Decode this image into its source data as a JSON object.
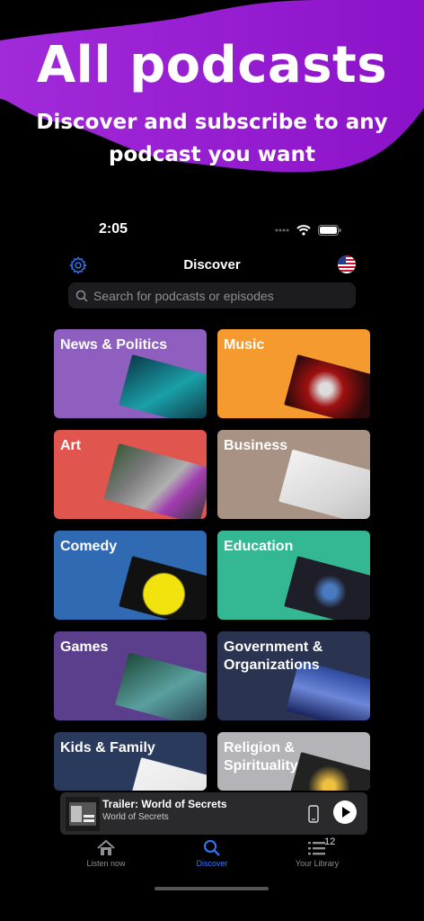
{
  "promo": {
    "headline": "All podcasts",
    "subline_1": "Discover and subscribe to any",
    "subline_2": "podcast you want"
  },
  "status": {
    "time": "2:05"
  },
  "nav": {
    "title": "Discover"
  },
  "search": {
    "placeholder": "Search for podcasts or episodes"
  },
  "categories": [
    {
      "label": "News & Politics",
      "color": "#8e5fbf"
    },
    {
      "label": "Music",
      "color": "#f49a2f"
    },
    {
      "label": "Art",
      "color": "#e0554e"
    },
    {
      "label": "Business",
      "color": "#a89283"
    },
    {
      "label": "Comedy",
      "color": "#2f6ab3"
    },
    {
      "label": "Education",
      "color": "#33b893"
    },
    {
      "label": "Games",
      "color": "#5c3f8c"
    },
    {
      "label": "Government & Organizations",
      "color": "#2a3350"
    },
    {
      "label": "Kids & Family",
      "color": "#2a3a5c"
    },
    {
      "label": "Religion & Spirituality",
      "color": "#b4b4b8"
    }
  ],
  "player": {
    "title": "Trailer: World of Secrets",
    "subtitle": "World of Secrets"
  },
  "tabs": [
    {
      "label": "Listen now"
    },
    {
      "label": "Discover"
    },
    {
      "label": "Your Library",
      "badge": "12"
    }
  ],
  "colors": {
    "accent": "#3478f6",
    "promo_blob": "#9b1fd6"
  }
}
